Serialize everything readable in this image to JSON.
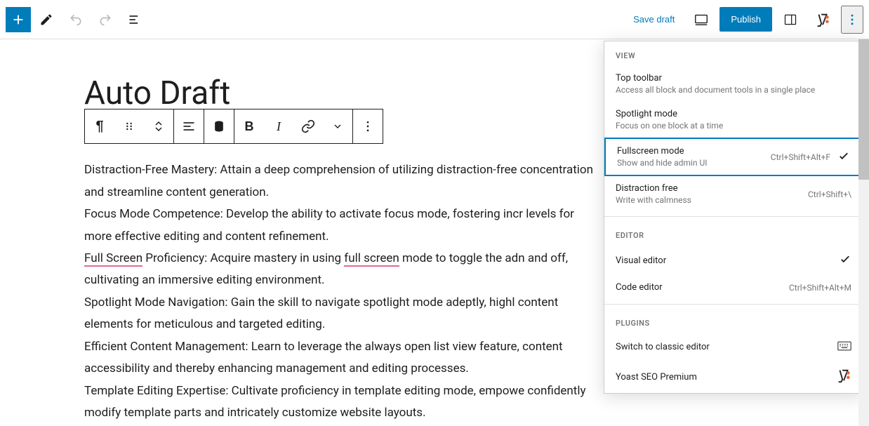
{
  "topbar": {
    "save_draft": "Save draft",
    "publish": "Publish"
  },
  "title": "Auto Draft",
  "paragraphs": [
    {
      "lead": "Distraction-Free Mastery:",
      "rest": " Attain a deep comprehension of utilizing distraction-free concentration and streamline content generation.",
      "segments": []
    },
    {
      "lead": "Focus Mode Competence:",
      "rest": " Develop the ability to activate focus mode, fostering incr levels for more effective editing and content refinement.",
      "segments": []
    },
    {
      "lead": "",
      "rest": "",
      "segments": [
        {
          "t": "Full Screen",
          "err": true
        },
        {
          "t": " Proficiency: Acquire mastery in using ",
          "err": false
        },
        {
          "t": "full screen",
          "err": true
        },
        {
          "t": " mode to toggle the adn and off, cultivating an immersive editing environment.",
          "err": false
        }
      ]
    },
    {
      "lead": "Spotlight Mode Navigation:",
      "rest": " Gain the skill to navigate spotlight mode adeptly, highl content elements for meticulous and targeted editing.",
      "segments": []
    },
    {
      "lead": "Efficient Content Management:",
      "rest": " Learn to leverage the always open list view feature, content accessibility and thereby enhancing management and editing processes.",
      "segments": []
    },
    {
      "lead": "Template Editing Expertise:",
      "rest": " Cultivate proficiency in template editing mode, empowe confidently modify template parts and intricately customize website layouts.",
      "segments": []
    }
  ],
  "dropdown": {
    "heading_view": "VIEW",
    "top_toolbar": {
      "label": "Top toolbar",
      "desc": "Access all block and document tools in a single place"
    },
    "spotlight": {
      "label": "Spotlight mode",
      "desc": "Focus on one block at a time"
    },
    "fullscreen": {
      "label": "Fullscreen mode",
      "desc": "Show and hide admin UI",
      "shortcut": "Ctrl+Shift+Alt+F"
    },
    "distraction": {
      "label": "Distraction free",
      "desc": "Write with calmness",
      "shortcut": "Ctrl+Shift+\\"
    },
    "heading_editor": "EDITOR",
    "visual": {
      "label": "Visual editor"
    },
    "code": {
      "label": "Code editor",
      "shortcut": "Ctrl+Shift+Alt+M"
    },
    "heading_plugins": "PLUGINS",
    "classic": {
      "label": "Switch to classic editor"
    },
    "yoast": {
      "label": "Yoast SEO Premium"
    }
  }
}
